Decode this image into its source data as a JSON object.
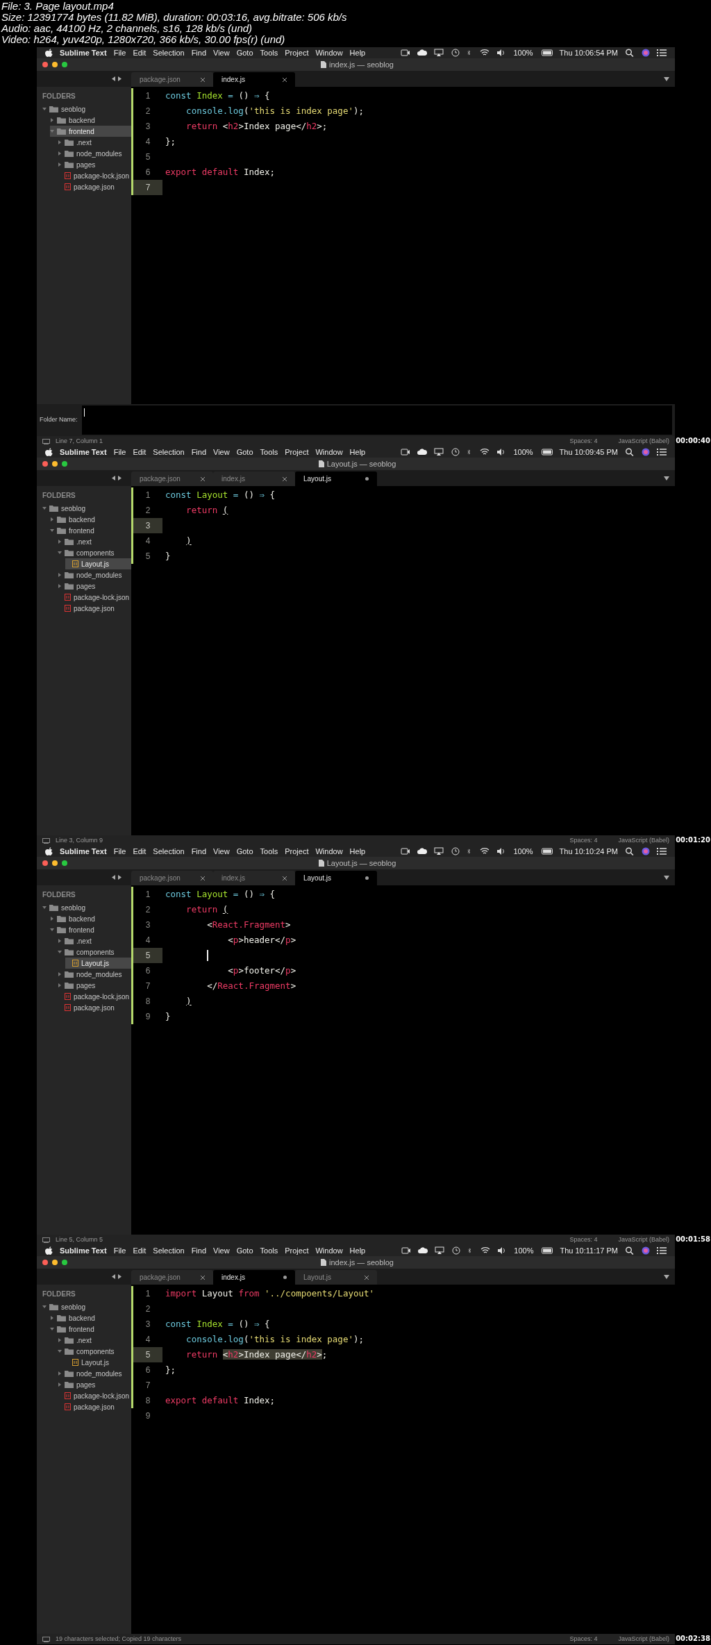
{
  "file_info": [
    "File: 3. Page layout.mp4",
    "Size: 12391774 bytes (11.82 MiB), duration: 00:03:16, avg.bitrate: 506 kb/s",
    "Audio: aac, 44100 Hz, 2 channels, s16, 128 kb/s (und)",
    "Video: h264, yuv420p, 1280x720, 366 kb/s, 30.00 fps(r) (und)"
  ],
  "frames": [
    {
      "menubar": {
        "app": "Sublime Text",
        "menus": [
          "File",
          "Edit",
          "Selection",
          "Find",
          "View",
          "Goto",
          "Tools",
          "Project",
          "Window",
          "Help"
        ],
        "battery": "100%",
        "clock": "Thu 10:06:54 PM"
      },
      "title": "index.js — seoblog",
      "tabs": [
        {
          "label": "package.json",
          "selected": false,
          "modified": false
        },
        {
          "label": "index.js",
          "selected": true,
          "modified": false
        }
      ],
      "sidebar": {
        "heading": "FOLDERS",
        "tree": [
          {
            "label": "seoblog",
            "kind": "folder",
            "expanded": true,
            "selected": false,
            "children": [
              {
                "label": "backend",
                "kind": "folder",
                "expanded": false,
                "selected": false
              },
              {
                "label": "frontend",
                "kind": "folder",
                "expanded": true,
                "selected": true,
                "children": [
                  {
                    "label": ".next",
                    "kind": "folder",
                    "expanded": false,
                    "selected": false
                  },
                  {
                    "label": "node_modules",
                    "kind": "folder",
                    "expanded": false,
                    "selected": false
                  },
                  {
                    "label": "pages",
                    "kind": "folder",
                    "expanded": false,
                    "selected": false
                  },
                  {
                    "label": "package-lock.json",
                    "kind": "json",
                    "selected": false
                  },
                  {
                    "label": "package.json",
                    "kind": "json",
                    "selected": false
                  }
                ]
              }
            ]
          }
        ]
      },
      "code": [
        {
          "number": "1",
          "current": false,
          "changed": true,
          "tokens": [
            {
              "t": "const",
              "kind": "storage"
            },
            {
              "t": " Index",
              "kind": "entity"
            },
            {
              "t": " =",
              "kind": "operator"
            },
            {
              "t": " () ",
              "kind": "plain"
            },
            {
              "t": "⇒",
              "kind": "operator"
            },
            {
              "t": " {",
              "kind": "plain"
            }
          ]
        },
        {
          "number": "2",
          "current": false,
          "changed": true,
          "tokens": [
            {
              "t": "    console.log",
              "kind": "support"
            },
            {
              "t": "(",
              "kind": "plain"
            },
            {
              "t": "'this is index page'",
              "kind": "string"
            },
            {
              "t": ");",
              "kind": "plain"
            }
          ]
        },
        {
          "number": "3",
          "current": false,
          "changed": true,
          "tokens": [
            {
              "t": "    return",
              "kind": "keyword"
            },
            {
              "t": " <",
              "kind": "plain"
            },
            {
              "t": "h2",
              "kind": "tag"
            },
            {
              "t": ">Index page</",
              "kind": "plain"
            },
            {
              "t": "h2",
              "kind": "tag"
            },
            {
              "t": ">;",
              "kind": "plain"
            }
          ]
        },
        {
          "number": "4",
          "current": false,
          "changed": true,
          "tokens": [
            {
              "t": "};",
              "kind": "plain"
            }
          ]
        },
        {
          "number": "5",
          "current": false,
          "changed": true
        },
        {
          "number": "6",
          "current": false,
          "changed": true,
          "tokens": [
            {
              "t": "export default",
              "kind": "keyword"
            },
            {
              "t": " Index;",
              "kind": "plain"
            }
          ]
        },
        {
          "number": "7",
          "current": true,
          "changed": true
        }
      ],
      "folder_prompt": {
        "label": "Folder Name:"
      },
      "status": {
        "left": "Line 7, Column 1",
        "spaces": "Spaces: 4",
        "syntax": "JavaScript (Babel)"
      },
      "timestamp": "00:00:40"
    },
    {
      "menubar": {
        "app": "Sublime Text",
        "menus": [
          "File",
          "Edit",
          "Selection",
          "Find",
          "View",
          "Goto",
          "Tools",
          "Project",
          "Window",
          "Help"
        ],
        "battery": "100%",
        "clock": "Thu 10:09:45 PM"
      },
      "title": "Layout.js — seoblog",
      "tabs": [
        {
          "label": "package.json",
          "selected": false,
          "modified": false
        },
        {
          "label": "index.js",
          "selected": false,
          "modified": false
        },
        {
          "label": "Layout.js",
          "selected": true,
          "modified": true
        }
      ],
      "sidebar": {
        "heading": "FOLDERS",
        "tree": [
          {
            "label": "seoblog",
            "kind": "folder",
            "expanded": true,
            "selected": false,
            "children": [
              {
                "label": "backend",
                "kind": "folder",
                "expanded": false,
                "selected": false
              },
              {
                "label": "frontend",
                "kind": "folder",
                "expanded": true,
                "selected": false,
                "children": [
                  {
                    "label": ".next",
                    "kind": "folder",
                    "expanded": false,
                    "selected": false
                  },
                  {
                    "label": "components",
                    "kind": "folder",
                    "expanded": true,
                    "selected": false,
                    "children": [
                      {
                        "label": "Layout.js",
                        "kind": "script",
                        "selected": true
                      }
                    ]
                  },
                  {
                    "label": "node_modules",
                    "kind": "folder",
                    "expanded": false,
                    "selected": false
                  },
                  {
                    "label": "pages",
                    "kind": "folder",
                    "expanded": false,
                    "selected": false
                  },
                  {
                    "label": "package-lock.json",
                    "kind": "json",
                    "selected": false
                  },
                  {
                    "label": "package.json",
                    "kind": "json",
                    "selected": false
                  }
                ]
              }
            ]
          }
        ]
      },
      "code": [
        {
          "number": "1",
          "current": false,
          "changed": true,
          "tokens": [
            {
              "t": "const",
              "kind": "storage"
            },
            {
              "t": " Layout",
              "kind": "entity"
            },
            {
              "t": " =",
              "kind": "operator"
            },
            {
              "t": " () ",
              "kind": "plain"
            },
            {
              "t": "⇒",
              "kind": "operator"
            },
            {
              "t": " {",
              "kind": "plain"
            }
          ]
        },
        {
          "number": "2",
          "current": false,
          "changed": true,
          "tokens": [
            {
              "t": "    return",
              "kind": "keyword"
            },
            {
              "t": " (",
              "kind": "bracket"
            }
          ]
        },
        {
          "number": "3",
          "current": true,
          "changed": true
        },
        {
          "number": "4",
          "current": false,
          "changed": true,
          "tokens": [
            {
              "t": "    )",
              "kind": "bracket"
            }
          ]
        },
        {
          "number": "5",
          "current": false,
          "changed": true,
          "tokens": [
            {
              "t": "}",
              "kind": "plain"
            }
          ]
        }
      ],
      "status": {
        "left": "Line 3, Column 9",
        "spaces": "Spaces: 4",
        "syntax": "JavaScript (Babel)"
      },
      "timestamp": "00:01:20"
    },
    {
      "menubar": {
        "app": "Sublime Text",
        "menus": [
          "File",
          "Edit",
          "Selection",
          "Find",
          "View",
          "Goto",
          "Tools",
          "Project",
          "Window",
          "Help"
        ],
        "battery": "100%",
        "clock": "Thu 10:10:24 PM"
      },
      "title": "Layout.js — seoblog",
      "tabs": [
        {
          "label": "package.json",
          "selected": false,
          "modified": false
        },
        {
          "label": "index.js",
          "selected": false,
          "modified": false
        },
        {
          "label": "Layout.js",
          "selected": true,
          "modified": true
        }
      ],
      "sidebar": {
        "heading": "FOLDERS",
        "tree": [
          {
            "label": "seoblog",
            "kind": "folder",
            "expanded": true,
            "selected": false,
            "children": [
              {
                "label": "backend",
                "kind": "folder",
                "expanded": false,
                "selected": false
              },
              {
                "label": "frontend",
                "kind": "folder",
                "expanded": true,
                "selected": false,
                "children": [
                  {
                    "label": ".next",
                    "kind": "folder",
                    "expanded": false,
                    "selected": false
                  },
                  {
                    "label": "components",
                    "kind": "folder",
                    "expanded": true,
                    "selected": false,
                    "children": [
                      {
                        "label": "Layout.js",
                        "kind": "script",
                        "selected": true
                      }
                    ]
                  },
                  {
                    "label": "node_modules",
                    "kind": "folder",
                    "expanded": false,
                    "selected": false
                  },
                  {
                    "label": "pages",
                    "kind": "folder",
                    "expanded": false,
                    "selected": false
                  },
                  {
                    "label": "package-lock.json",
                    "kind": "json",
                    "selected": false
                  },
                  {
                    "label": "package.json",
                    "kind": "json",
                    "selected": false
                  }
                ]
              }
            ]
          }
        ]
      },
      "code": [
        {
          "number": "1",
          "current": false,
          "changed": true,
          "tokens": [
            {
              "t": "const",
              "kind": "storage"
            },
            {
              "t": " Layout",
              "kind": "entity"
            },
            {
              "t": " =",
              "kind": "operator"
            },
            {
              "t": " () ",
              "kind": "plain"
            },
            {
              "t": "⇒",
              "kind": "operator"
            },
            {
              "t": " {",
              "kind": "plain"
            }
          ]
        },
        {
          "number": "2",
          "current": false,
          "changed": true,
          "tokens": [
            {
              "t": "    return",
              "kind": "keyword"
            },
            {
              "t": " (",
              "kind": "bracket"
            }
          ]
        },
        {
          "number": "3",
          "current": false,
          "changed": true,
          "tokens": [
            {
              "t": "        <",
              "kind": "plain"
            },
            {
              "t": "React.Fragment",
              "kind": "tag"
            },
            {
              "t": ">",
              "kind": "plain"
            }
          ]
        },
        {
          "number": "4",
          "current": false,
          "changed": true,
          "tokens": [
            {
              "t": "            <",
              "kind": "plain"
            },
            {
              "t": "p",
              "kind": "tag"
            },
            {
              "t": ">header</",
              "kind": "plain"
            },
            {
              "t": "p",
              "kind": "tag"
            },
            {
              "t": ">",
              "kind": "plain"
            }
          ]
        },
        {
          "number": "5",
          "current": true,
          "changed": true,
          "cursor": true
        },
        {
          "number": "6",
          "current": false,
          "changed": true,
          "tokens": [
            {
              "t": "            <",
              "kind": "plain"
            },
            {
              "t": "p",
              "kind": "tag"
            },
            {
              "t": ">footer</",
              "kind": "plain"
            },
            {
              "t": "p",
              "kind": "tag"
            },
            {
              "t": ">",
              "kind": "plain"
            }
          ]
        },
        {
          "number": "7",
          "current": false,
          "changed": true,
          "tokens": [
            {
              "t": "        </",
              "kind": "plain"
            },
            {
              "t": "React.Fragment",
              "kind": "tag"
            },
            {
              "t": ">",
              "kind": "plain"
            }
          ]
        },
        {
          "number": "8",
          "current": false,
          "changed": true,
          "tokens": [
            {
              "t": "    )",
              "kind": "bracket"
            }
          ]
        },
        {
          "number": "9",
          "current": false,
          "changed": true,
          "tokens": [
            {
              "t": "}",
              "kind": "plain"
            }
          ]
        }
      ],
      "status": {
        "left": "Line 5, Column 5",
        "spaces": "Spaces: 4",
        "syntax": "JavaScript (Babel)"
      },
      "timestamp": "00:01:58"
    },
    {
      "menubar": {
        "app": "Sublime Text",
        "menus": [
          "File",
          "Edit",
          "Selection",
          "Find",
          "View",
          "Goto",
          "Tools",
          "Project",
          "Window",
          "Help"
        ],
        "battery": "100%",
        "clock": "Thu 10:11:17 PM"
      },
      "title": "index.js — seoblog",
      "tabs": [
        {
          "label": "package.json",
          "selected": false,
          "modified": false
        },
        {
          "label": "index.js",
          "selected": true,
          "modified": true
        },
        {
          "label": "Layout.js",
          "selected": false,
          "modified": false
        }
      ],
      "sidebar": {
        "heading": "FOLDERS",
        "tree": [
          {
            "label": "seoblog",
            "kind": "folder",
            "expanded": true,
            "selected": false,
            "children": [
              {
                "label": "backend",
                "kind": "folder",
                "expanded": false,
                "selected": false
              },
              {
                "label": "frontend",
                "kind": "folder",
                "expanded": true,
                "selected": false,
                "children": [
                  {
                    "label": ".next",
                    "kind": "folder",
                    "expanded": false,
                    "selected": false
                  },
                  {
                    "label": "components",
                    "kind": "folder",
                    "expanded": true,
                    "selected": false,
                    "children": [
                      {
                        "label": "Layout.js",
                        "kind": "script",
                        "selected": false
                      }
                    ]
                  },
                  {
                    "label": "node_modules",
                    "kind": "folder",
                    "expanded": false,
                    "selected": false
                  },
                  {
                    "label": "pages",
                    "kind": "folder",
                    "expanded": false,
                    "selected": false
                  },
                  {
                    "label": "package-lock.json",
                    "kind": "json",
                    "selected": false
                  },
                  {
                    "label": "package.json",
                    "kind": "json",
                    "selected": false
                  }
                ]
              }
            ]
          }
        ]
      },
      "code": [
        {
          "number": "1",
          "current": false,
          "changed": true,
          "tokens": [
            {
              "t": "import",
              "kind": "keyword"
            },
            {
              "t": " Layout ",
              "kind": "plain"
            },
            {
              "t": "from",
              "kind": "keyword"
            },
            {
              "t": " '../compoents/Layout'",
              "kind": "string"
            }
          ]
        },
        {
          "number": "2",
          "current": false,
          "changed": true
        },
        {
          "number": "3",
          "current": false,
          "changed": true,
          "tokens": [
            {
              "t": "const",
              "kind": "storage"
            },
            {
              "t": " Index",
              "kind": "entity"
            },
            {
              "t": " =",
              "kind": "operator"
            },
            {
              "t": " () ",
              "kind": "plain"
            },
            {
              "t": "⇒",
              "kind": "operator"
            },
            {
              "t": " {",
              "kind": "plain"
            }
          ]
        },
        {
          "number": "4",
          "current": false,
          "changed": true,
          "tokens": [
            {
              "t": "    console.log",
              "kind": "support"
            },
            {
              "t": "(",
              "kind": "plain"
            },
            {
              "t": "'this is index page'",
              "kind": "string"
            },
            {
              "t": ");",
              "kind": "plain"
            }
          ]
        },
        {
          "number": "5",
          "current": true,
          "changed": true,
          "tokens": [
            {
              "t": "    return ",
              "kind": "keyword"
            },
            {
              "t": "<",
              "kind": "plain",
              "sel": true
            },
            {
              "t": "h2",
              "kind": "tag",
              "sel": true
            },
            {
              "t": ">Index page</",
              "kind": "plain",
              "sel": true
            },
            {
              "t": "h2",
              "kind": "tag",
              "sel": true
            },
            {
              "t": ">",
              "kind": "plain",
              "sel": true
            },
            {
              "t": ";",
              "kind": "plain"
            }
          ]
        },
        {
          "number": "6",
          "current": false,
          "changed": true,
          "tokens": [
            {
              "t": "};",
              "kind": "plain"
            }
          ]
        },
        {
          "number": "7",
          "current": false,
          "changed": true
        },
        {
          "number": "8",
          "current": false,
          "changed": true,
          "tokens": [
            {
              "t": "export default",
              "kind": "keyword"
            },
            {
              "t": " Index;",
              "kind": "plain"
            }
          ]
        },
        {
          "number": "9",
          "current": false,
          "changed": false
        }
      ],
      "status": {
        "left": "19 characters selected; Copied 19 characters",
        "spaces": "Spaces: 4",
        "syntax": "JavaScript (Babel)"
      },
      "timestamp": "00:02:38"
    }
  ]
}
